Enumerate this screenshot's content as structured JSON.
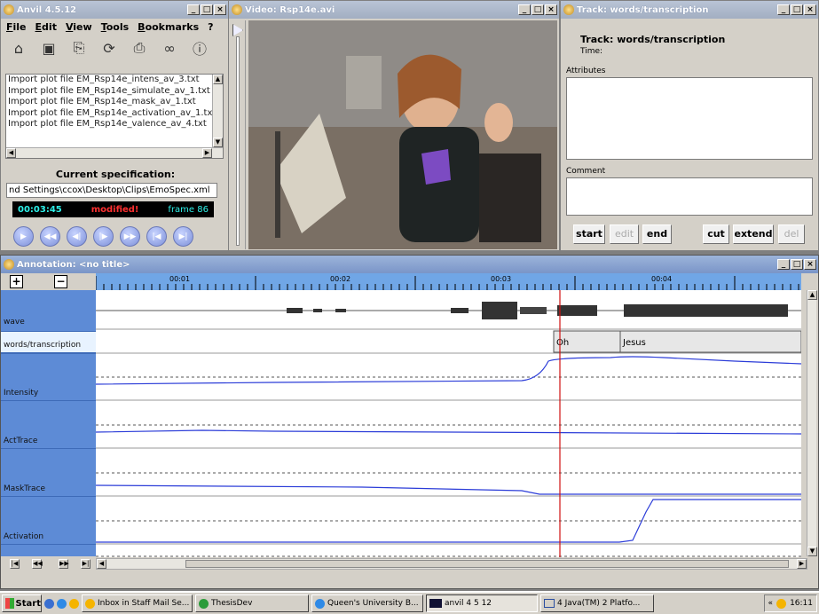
{
  "anvil_window": {
    "title": "Anvil 4.5.12",
    "menu": [
      "File",
      "Edit",
      "View",
      "Tools",
      "Bookmarks",
      "?"
    ],
    "toolbar_icons": [
      "open-folder-icon",
      "save-icon",
      "new-document-icon",
      "refresh-icon",
      "print-icon",
      "binoculars-icon",
      "info-icon"
    ],
    "log_lines": [
      "Import plot file EM_Rsp14e_intens_av_3.txt",
      "Import plot file EM_Rsp14e_simulate_av_1.txt",
      "Import plot file EM_Rsp14e_mask_av_1.txt",
      "Import plot file EM_Rsp14e_activation_av_1.txt",
      "Import plot file EM_Rsp14e_valence_av_4.txt"
    ],
    "spec_label": "Current specification:",
    "spec_path": "nd Settings\\ccox\\Desktop\\Clips\\EmoSpec.xml",
    "timecode": "00:03:45",
    "status": "modified!",
    "frame": "frame 86",
    "playback_buttons": [
      "play-icon",
      "rewind-fast-icon",
      "rewind-icon",
      "step-icon",
      "forward-icon",
      "forward-fast-icon",
      "end-icon"
    ]
  },
  "video_window": {
    "title": "Video: Rsp14e.avi"
  },
  "track_window": {
    "title": "Track: words/transcription",
    "heading": "Track: words/transcription",
    "time_label": "Time:",
    "attributes_label": "Attributes",
    "comment_label": "Comment",
    "buttons": {
      "start": "start",
      "edit": "edit",
      "end": "end",
      "cut": "cut",
      "extend": "extend",
      "del": "del"
    }
  },
  "annotation_window": {
    "title": "Annotation: <no title>",
    "zoom_in": "+",
    "zoom_out": "−",
    "ruler_marks": [
      "00:01",
      "00:02",
      "00:03",
      "00:04"
    ],
    "tracks": [
      "wave",
      "words/transcription",
      "Intensity",
      "ActTrace",
      "MaskTrace",
      "Activation"
    ],
    "words": [
      "Oh",
      "Jesus"
    ]
  },
  "taskbar": {
    "start": "Start",
    "tasks": [
      "Inbox in Staff Mail Se...",
      "ThesisDev",
      "Queen's University B...",
      "anvil 4 5 12",
      "4 Java(TM) 2 Platfo..."
    ],
    "clock": "16:11"
  },
  "colors": {
    "track_blue": "#5d8bd6",
    "ruler_blue": "#70a6e6",
    "cursor_red": "#d01010",
    "plot_line": "#2b3cd8"
  }
}
